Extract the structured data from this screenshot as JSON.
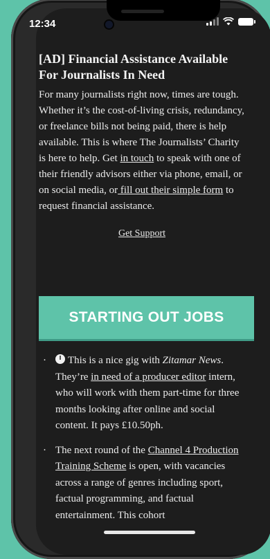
{
  "status_bar": {
    "time": "12:34"
  },
  "ad": {
    "title": "[AD] Financial Assistance Available For Journalists In Need",
    "body_1": "For many journalists right now, times are tough. Whether it’s the cost-of-living crisis, redundancy, or freelance bills not being paid, there is help available. This is where The Journalists’ Charity is here to help. Get ",
    "link_1": "in touch",
    "body_2": " to speak with one of their friendly advisors either via phone, email, or on social media, or",
    "link_2": " fill out their simple form",
    "body_3": " to request financial assistance.",
    "support_link": "Get Support"
  },
  "banner": {
    "title": "STARTING OUT JOBS"
  },
  "jobs": [
    {
      "icon": "clock-icon",
      "text_1": "This is a nice gig with ",
      "company": "Zitamar News",
      "text_2": ". They’re ",
      "link": "in need of a producer editor",
      "text_3": " intern, who will work with them part-time for three months looking after online and social content. It pays £10.50ph."
    },
    {
      "text_1": "The next round of the ",
      "link": "Channel 4 Production Training Scheme",
      "text_2": " is open, with vacancies across a range of genres including sport, factual programming, and factual entertainment. This cohort"
    }
  ],
  "colors": {
    "accent": "#5ec3a9",
    "screen_bg": "#1d1d1d"
  }
}
